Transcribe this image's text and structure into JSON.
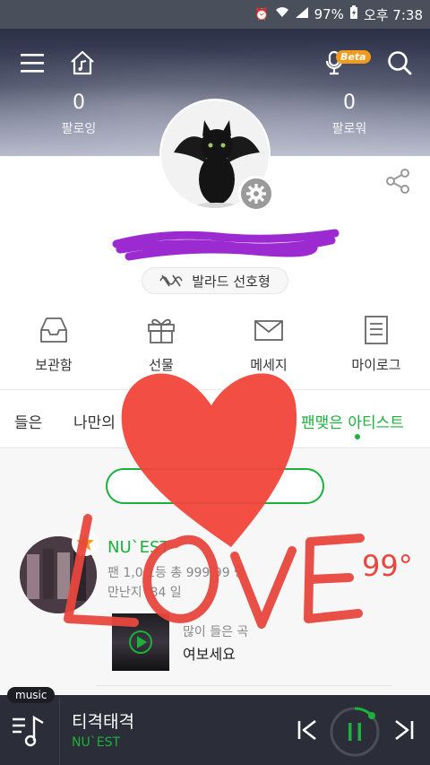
{
  "status_bar": {
    "battery": "97%",
    "time": "오후 7:38"
  },
  "header": {
    "beta_label": "Beta",
    "following": {
      "count": "0",
      "label": "팔로잉"
    },
    "followers": {
      "count": "0",
      "label": "팔로워"
    }
  },
  "profile": {
    "genre_label": "발라드 선호형"
  },
  "quick_menu": [
    {
      "label": "보관함",
      "icon": "inbox-icon"
    },
    {
      "label": "선물",
      "icon": "gift-icon"
    },
    {
      "label": "메세지",
      "icon": "mail-icon"
    },
    {
      "label": "마이로그",
      "icon": "document-icon"
    }
  ],
  "tabs": [
    {
      "label": "들은"
    },
    {
      "label": "나만의"
    },
    {
      "label": "팬맺은 아티스트",
      "active": true
    }
  ],
  "artist": {
    "name": "NU`EST",
    "fans_line": "팬 1,0  1등 총 999,99  명",
    "since_line": "만난지  ,84  일",
    "degree": "99°",
    "most_played_label": "많이 들은 곡",
    "most_played_track": "여보세요"
  },
  "player": {
    "tag": "music",
    "title": "티격태격",
    "artist": "NU`EST"
  },
  "colors": {
    "accent_green": "#19b23b",
    "beta_orange": "#f29a1b",
    "drawing_red": "#e8473d",
    "scribble_purple": "#9b2ad1"
  }
}
